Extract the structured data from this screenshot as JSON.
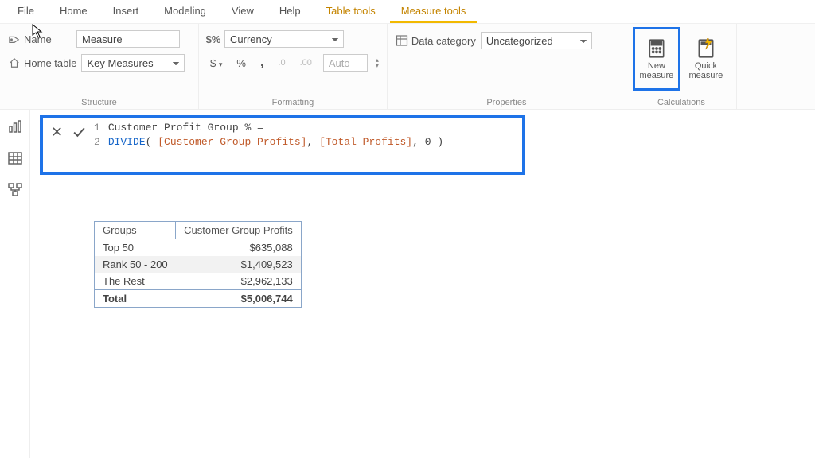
{
  "tabs": {
    "file": "File",
    "home": "Home",
    "insert": "Insert",
    "modeling": "Modeling",
    "view": "View",
    "help": "Help",
    "tabletools": "Table tools",
    "measuretools": "Measure tools"
  },
  "structure": {
    "group_label": "Structure",
    "name_label": "Name",
    "name_value": "Measure",
    "hometable_label": "Home table",
    "hometable_value": "Key Measures"
  },
  "formatting": {
    "group_label": "Formatting",
    "format_value": "Currency",
    "currency_symbol": "$",
    "percent": "%",
    "thousands": ",",
    "decimals_dec": ".0",
    "decimals_inc": ".00",
    "auto": "Auto"
  },
  "properties": {
    "group_label": "Properties",
    "datacat_label": "Data category",
    "datacat_value": "Uncategorized"
  },
  "calculations": {
    "group_label": "Calculations",
    "new_measure": "New measure",
    "quick_measure": "Quick measure"
  },
  "formula": {
    "line1_num": "1",
    "line1_text": "Customer Profit Group % =",
    "line2_num": "2",
    "line2_fn": "DIVIDE",
    "line2_open": "( ",
    "line2_m1": "[Customer Group Profits]",
    "line2_sep1": ", ",
    "line2_m2": "[Total Profits]",
    "line2_sep2": ", 0 ",
    "line2_close": ")"
  },
  "table": {
    "headers": {
      "c1": "Groups",
      "c2": "Customer Group Profits"
    },
    "rows": [
      {
        "group": "Top 50",
        "value": "$635,088"
      },
      {
        "group": "Rank 50 - 200",
        "value": "$1,409,523"
      },
      {
        "group": "The Rest",
        "value": "$2,962,133"
      }
    ],
    "total_label": "Total",
    "total_value": "$5,006,744"
  }
}
